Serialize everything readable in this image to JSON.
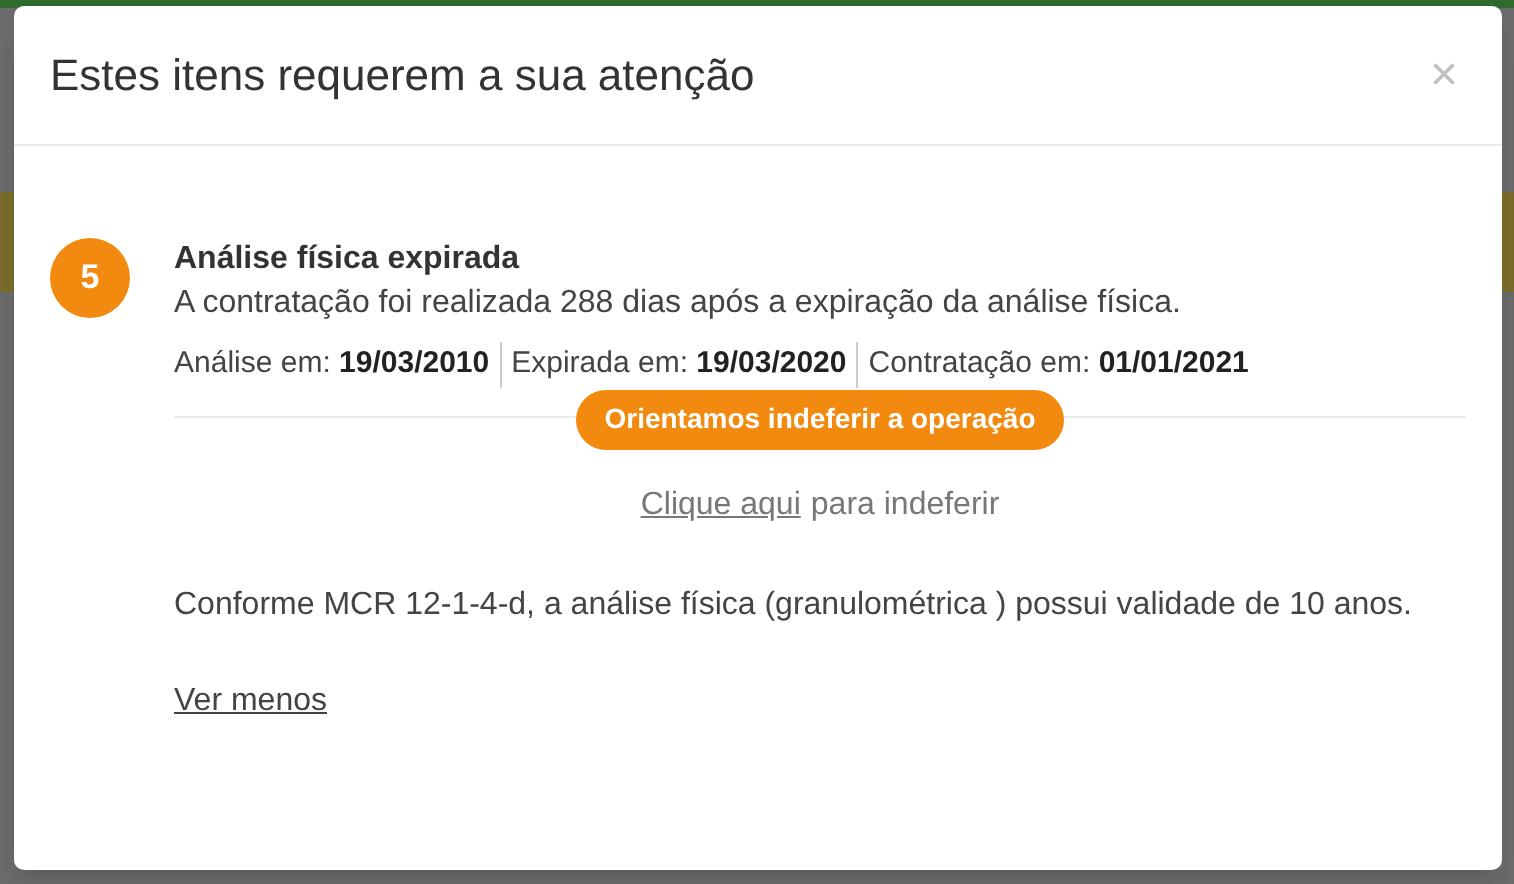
{
  "modal": {
    "title": "Estes itens requerem a sua atenção",
    "close": "×"
  },
  "alert": {
    "number": "5",
    "title": "Análise física expirada",
    "description": "A contratação foi realizada 288 dias após a expiração da análise física.",
    "facts": [
      {
        "label": "Análise em:",
        "value": "19/03/2010"
      },
      {
        "label": "Expirada em:",
        "value": "19/03/2020"
      },
      {
        "label": "Contratação em:",
        "value": "01/01/2021"
      }
    ],
    "recommendation": "Orientamos indeferir a operação",
    "action": {
      "link": "Clique aqui",
      "text": "para indeferir"
    },
    "note": "Conforme MCR 12-1-4-d, a análise física (granulométrica ) possui validade de 10 anos.",
    "toggle": "Ver menos"
  }
}
